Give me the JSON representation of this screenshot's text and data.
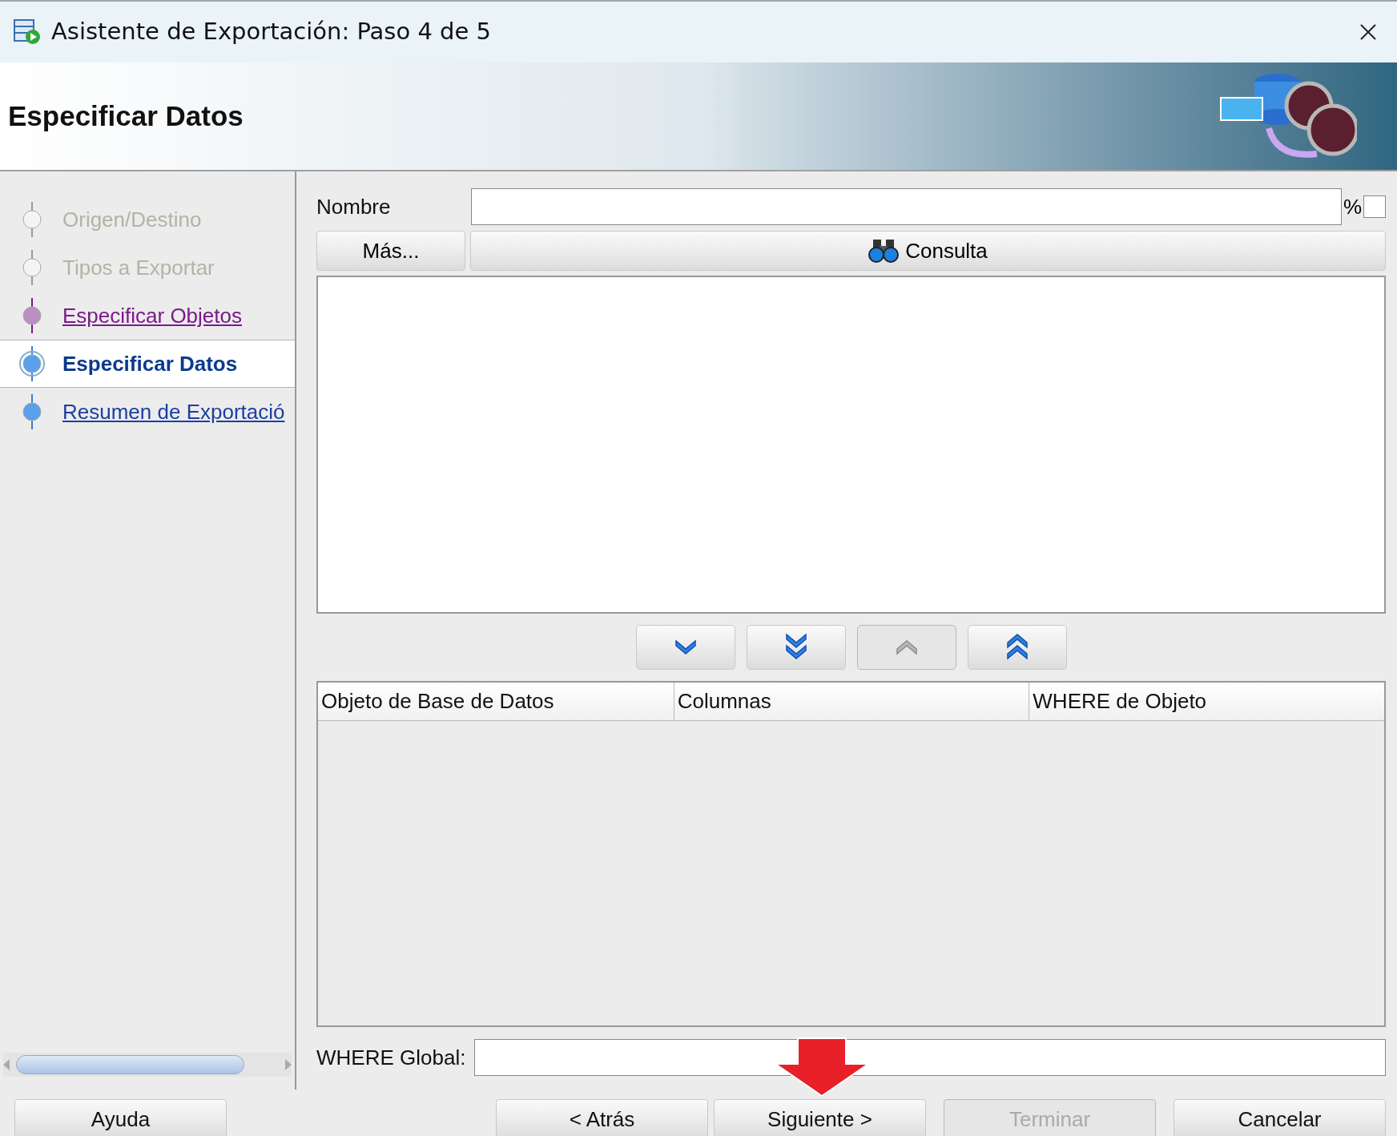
{
  "window": {
    "title": "Asistente de Exportación: Paso 4 de 5"
  },
  "header": {
    "title": "Especificar Datos"
  },
  "steps": [
    {
      "label": "Origen/Destino",
      "kind": "disabled",
      "selected": false
    },
    {
      "label": "Tipos a Exportar",
      "kind": "disabled",
      "selected": false
    },
    {
      "label": "Especificar Objetos",
      "kind": "visited",
      "selected": false
    },
    {
      "label": "Especificar Datos",
      "kind": "current",
      "selected": true
    },
    {
      "label": "Resumen de Exportació",
      "kind": "link",
      "selected": false
    }
  ],
  "name_field": {
    "label": "Nombre",
    "percent_label": "%",
    "percent_checked": false
  },
  "more_button": "Más...",
  "query_button": "Consulta",
  "move_buttons": [
    {
      "kind": "down",
      "disabled": false
    },
    {
      "kind": "all-down",
      "disabled": false
    },
    {
      "kind": "up",
      "disabled": true
    },
    {
      "kind": "all-up",
      "disabled": false
    }
  ],
  "table": {
    "columns": [
      "Objeto de Base de Datos",
      "Columnas",
      "WHERE de Objeto"
    ]
  },
  "global_where": {
    "label": "WHERE Global:"
  },
  "buttons": [
    {
      "label": "Ayuda",
      "disabled": false
    },
    {
      "label": "< Atrás",
      "disabled": false
    },
    {
      "label": "Siguiente >",
      "disabled": false
    },
    {
      "label": "Terminar",
      "disabled": true
    },
    {
      "label": "Cancelar",
      "disabled": false
    }
  ]
}
